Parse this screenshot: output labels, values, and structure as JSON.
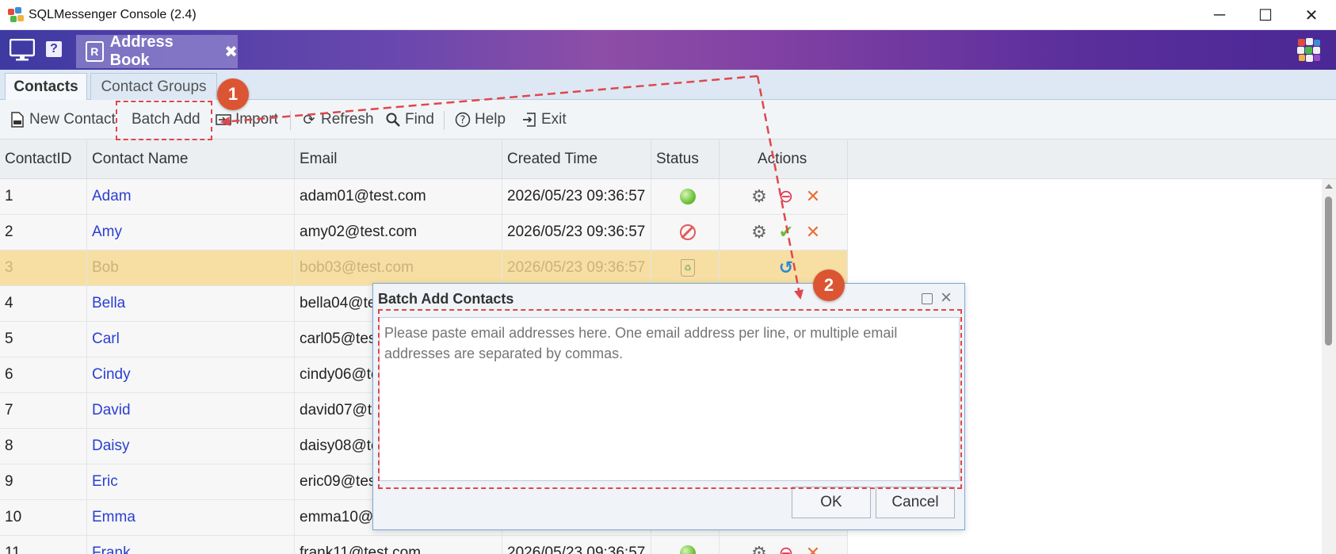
{
  "window": {
    "title": "SQLMessenger Console (2.4)",
    "minimize": "─",
    "maximize": "☐",
    "close": "✕"
  },
  "header": {
    "help": "?",
    "tab": {
      "icon_letter": "R",
      "label": "Address Book",
      "close": "✖"
    }
  },
  "subtabs": [
    {
      "label": "Contacts",
      "active": true
    },
    {
      "label": "Contact Groups",
      "active": false
    }
  ],
  "toolbar": {
    "new_contact": "New Contact",
    "batch_add": "Batch Add",
    "import": "Import",
    "refresh": "Refresh",
    "find": "Find",
    "help": "Help",
    "exit": "Exit"
  },
  "table": {
    "columns": [
      "ContactID",
      "Contact Name",
      "Email",
      "Created Time",
      "Status",
      "Actions"
    ],
    "rows": [
      {
        "id": "1",
        "name": "Adam",
        "email": "adam01@test.com",
        "created": "2026/05/23 09:36:57",
        "status": "active"
      },
      {
        "id": "2",
        "name": "Amy",
        "email": "amy02@test.com",
        "created": "2026/05/23 09:36:57",
        "status": "disabled"
      },
      {
        "id": "3",
        "name": "Bob",
        "email": "bob03@test.com",
        "created": "2026/05/23 09:36:57",
        "status": "deleted"
      },
      {
        "id": "4",
        "name": "Bella",
        "email": "bella04@te",
        "created": "",
        "status": ""
      },
      {
        "id": "5",
        "name": "Carl",
        "email": "carl05@tes",
        "created": "",
        "status": ""
      },
      {
        "id": "6",
        "name": "Cindy",
        "email": "cindy06@te",
        "created": "",
        "status": ""
      },
      {
        "id": "7",
        "name": "David",
        "email": "david07@t",
        "created": "",
        "status": ""
      },
      {
        "id": "8",
        "name": "Daisy",
        "email": "daisy08@te",
        "created": "",
        "status": ""
      },
      {
        "id": "9",
        "name": "Eric",
        "email": "eric09@tes",
        "created": "",
        "status": ""
      },
      {
        "id": "10",
        "name": "Emma",
        "email": "emma10@",
        "created": "",
        "status": ""
      },
      {
        "id": "11",
        "name": "Frank",
        "email": "frank11@test.com",
        "created": "2026/05/23 09:36:57",
        "status": "active"
      }
    ]
  },
  "dialog": {
    "title": "Batch Add Contacts",
    "placeholder": "Please paste email addresses here. One email address per line, or multiple email addresses are separated by commas.",
    "ok": "OK",
    "cancel": "Cancel"
  },
  "annotations": {
    "badge1": "1",
    "badge2": "2",
    "color": "#e0474c"
  },
  "colors": {
    "header_gradient_start": "#3d3aa2",
    "header_gradient_mid": "#8d4ea7",
    "selected_row": "#f7dfa3",
    "link": "#2a3fd0"
  }
}
